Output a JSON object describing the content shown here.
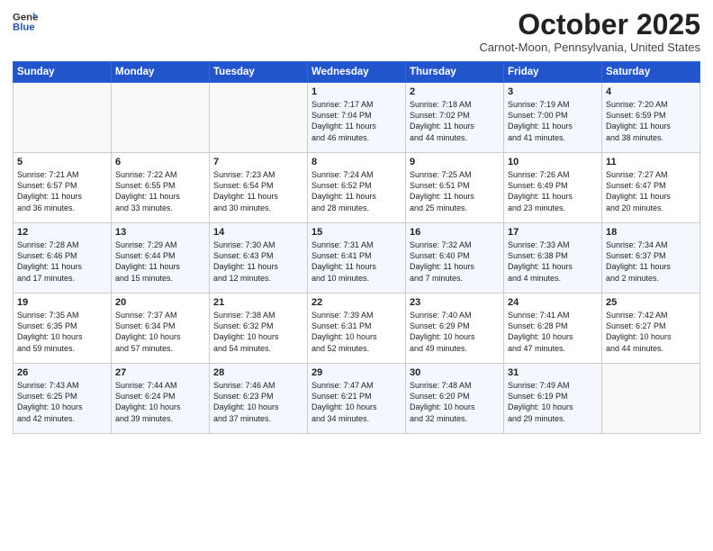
{
  "header": {
    "logo_general": "General",
    "logo_blue": "Blue",
    "month_title": "October 2025",
    "subtitle": "Carnot-Moon, Pennsylvania, United States"
  },
  "days_of_week": [
    "Sunday",
    "Monday",
    "Tuesday",
    "Wednesday",
    "Thursday",
    "Friday",
    "Saturday"
  ],
  "weeks": [
    [
      {
        "day": "",
        "info": ""
      },
      {
        "day": "",
        "info": ""
      },
      {
        "day": "",
        "info": ""
      },
      {
        "day": "1",
        "info": "Sunrise: 7:17 AM\nSunset: 7:04 PM\nDaylight: 11 hours\nand 46 minutes."
      },
      {
        "day": "2",
        "info": "Sunrise: 7:18 AM\nSunset: 7:02 PM\nDaylight: 11 hours\nand 44 minutes."
      },
      {
        "day": "3",
        "info": "Sunrise: 7:19 AM\nSunset: 7:00 PM\nDaylight: 11 hours\nand 41 minutes."
      },
      {
        "day": "4",
        "info": "Sunrise: 7:20 AM\nSunset: 6:59 PM\nDaylight: 11 hours\nand 38 minutes."
      }
    ],
    [
      {
        "day": "5",
        "info": "Sunrise: 7:21 AM\nSunset: 6:57 PM\nDaylight: 11 hours\nand 36 minutes."
      },
      {
        "day": "6",
        "info": "Sunrise: 7:22 AM\nSunset: 6:55 PM\nDaylight: 11 hours\nand 33 minutes."
      },
      {
        "day": "7",
        "info": "Sunrise: 7:23 AM\nSunset: 6:54 PM\nDaylight: 11 hours\nand 30 minutes."
      },
      {
        "day": "8",
        "info": "Sunrise: 7:24 AM\nSunset: 6:52 PM\nDaylight: 11 hours\nand 28 minutes."
      },
      {
        "day": "9",
        "info": "Sunrise: 7:25 AM\nSunset: 6:51 PM\nDaylight: 11 hours\nand 25 minutes."
      },
      {
        "day": "10",
        "info": "Sunrise: 7:26 AM\nSunset: 6:49 PM\nDaylight: 11 hours\nand 23 minutes."
      },
      {
        "day": "11",
        "info": "Sunrise: 7:27 AM\nSunset: 6:47 PM\nDaylight: 11 hours\nand 20 minutes."
      }
    ],
    [
      {
        "day": "12",
        "info": "Sunrise: 7:28 AM\nSunset: 6:46 PM\nDaylight: 11 hours\nand 17 minutes."
      },
      {
        "day": "13",
        "info": "Sunrise: 7:29 AM\nSunset: 6:44 PM\nDaylight: 11 hours\nand 15 minutes."
      },
      {
        "day": "14",
        "info": "Sunrise: 7:30 AM\nSunset: 6:43 PM\nDaylight: 11 hours\nand 12 minutes."
      },
      {
        "day": "15",
        "info": "Sunrise: 7:31 AM\nSunset: 6:41 PM\nDaylight: 11 hours\nand 10 minutes."
      },
      {
        "day": "16",
        "info": "Sunrise: 7:32 AM\nSunset: 6:40 PM\nDaylight: 11 hours\nand 7 minutes."
      },
      {
        "day": "17",
        "info": "Sunrise: 7:33 AM\nSunset: 6:38 PM\nDaylight: 11 hours\nand 4 minutes."
      },
      {
        "day": "18",
        "info": "Sunrise: 7:34 AM\nSunset: 6:37 PM\nDaylight: 11 hours\nand 2 minutes."
      }
    ],
    [
      {
        "day": "19",
        "info": "Sunrise: 7:35 AM\nSunset: 6:35 PM\nDaylight: 10 hours\nand 59 minutes."
      },
      {
        "day": "20",
        "info": "Sunrise: 7:37 AM\nSunset: 6:34 PM\nDaylight: 10 hours\nand 57 minutes."
      },
      {
        "day": "21",
        "info": "Sunrise: 7:38 AM\nSunset: 6:32 PM\nDaylight: 10 hours\nand 54 minutes."
      },
      {
        "day": "22",
        "info": "Sunrise: 7:39 AM\nSunset: 6:31 PM\nDaylight: 10 hours\nand 52 minutes."
      },
      {
        "day": "23",
        "info": "Sunrise: 7:40 AM\nSunset: 6:29 PM\nDaylight: 10 hours\nand 49 minutes."
      },
      {
        "day": "24",
        "info": "Sunrise: 7:41 AM\nSunset: 6:28 PM\nDaylight: 10 hours\nand 47 minutes."
      },
      {
        "day": "25",
        "info": "Sunrise: 7:42 AM\nSunset: 6:27 PM\nDaylight: 10 hours\nand 44 minutes."
      }
    ],
    [
      {
        "day": "26",
        "info": "Sunrise: 7:43 AM\nSunset: 6:25 PM\nDaylight: 10 hours\nand 42 minutes."
      },
      {
        "day": "27",
        "info": "Sunrise: 7:44 AM\nSunset: 6:24 PM\nDaylight: 10 hours\nand 39 minutes."
      },
      {
        "day": "28",
        "info": "Sunrise: 7:46 AM\nSunset: 6:23 PM\nDaylight: 10 hours\nand 37 minutes."
      },
      {
        "day": "29",
        "info": "Sunrise: 7:47 AM\nSunset: 6:21 PM\nDaylight: 10 hours\nand 34 minutes."
      },
      {
        "day": "30",
        "info": "Sunrise: 7:48 AM\nSunset: 6:20 PM\nDaylight: 10 hours\nand 32 minutes."
      },
      {
        "day": "31",
        "info": "Sunrise: 7:49 AM\nSunset: 6:19 PM\nDaylight: 10 hours\nand 29 minutes."
      },
      {
        "day": "",
        "info": ""
      }
    ]
  ]
}
